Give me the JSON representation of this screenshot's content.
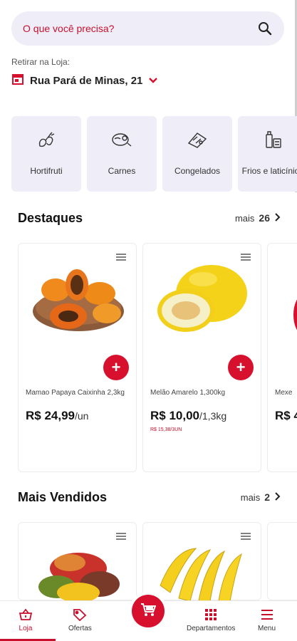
{
  "search": {
    "placeholder": "O que você precisa?",
    "icon": "search-icon"
  },
  "pickup": {
    "label": "Retirar na Loja:",
    "address": "Rua Pará de Minas, 21"
  },
  "categories": [
    {
      "label": "Hortifruti",
      "icon": "vegetables-icon"
    },
    {
      "label": "Carnes",
      "icon": "meat-icon"
    },
    {
      "label": "Congelados",
      "icon": "frozen-icon"
    },
    {
      "label": "Frios e laticínios",
      "icon": "dairy-icon"
    }
  ],
  "highlights": {
    "title": "Destaques",
    "more_label": "mais",
    "more_count": "26",
    "products": [
      {
        "name": "Mamao Papaya Caixinha 2,3kg",
        "price": "R$ 24,99",
        "unit": "/un",
        "sub": ""
      },
      {
        "name": "Melão Amarelo 1,300kg",
        "price": "R$ 10,00",
        "unit": "/1,3kg",
        "sub": "R$ 15,38/3UN"
      },
      {
        "name": "Mexe",
        "price": "R$ 4",
        "unit": "",
        "sub": ""
      }
    ]
  },
  "best_sellers": {
    "title": "Mais Vendidos",
    "more_label": "mais",
    "more_count": "2"
  },
  "nav": {
    "store": "Loja",
    "offers": "Ofertas",
    "departments": "Departamentos",
    "menu": "Menu"
  },
  "colors": {
    "accent": "#d7102e",
    "tile_bg": "#efeef8"
  }
}
